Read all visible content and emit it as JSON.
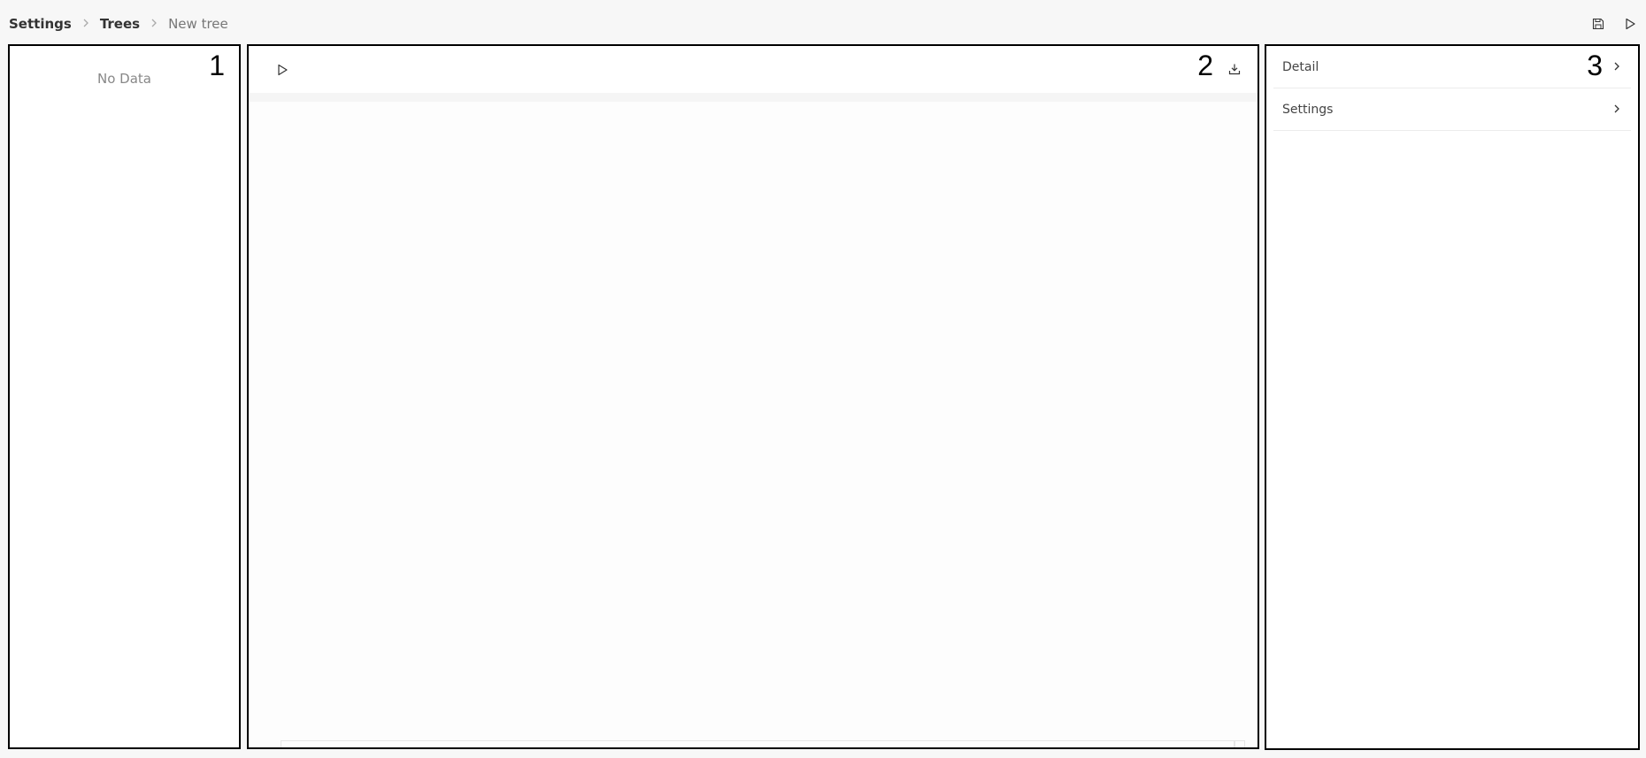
{
  "breadcrumb": {
    "items": [
      "Settings",
      "Trees",
      "New tree"
    ]
  },
  "top_actions": {
    "save_icon": "save-icon",
    "run_icon": "play-icon"
  },
  "panels": {
    "left": {
      "number": "1",
      "empty_text": "No Data"
    },
    "center": {
      "number": "2",
      "play_icon": "play-icon",
      "download_icon": "download-icon"
    },
    "right": {
      "number": "3",
      "menu": [
        {
          "label": "Detail"
        },
        {
          "label": "Settings"
        }
      ]
    }
  },
  "colors": {
    "background": "#f7f7f7",
    "panel_border": "#000000",
    "muted_text": "#888888"
  }
}
